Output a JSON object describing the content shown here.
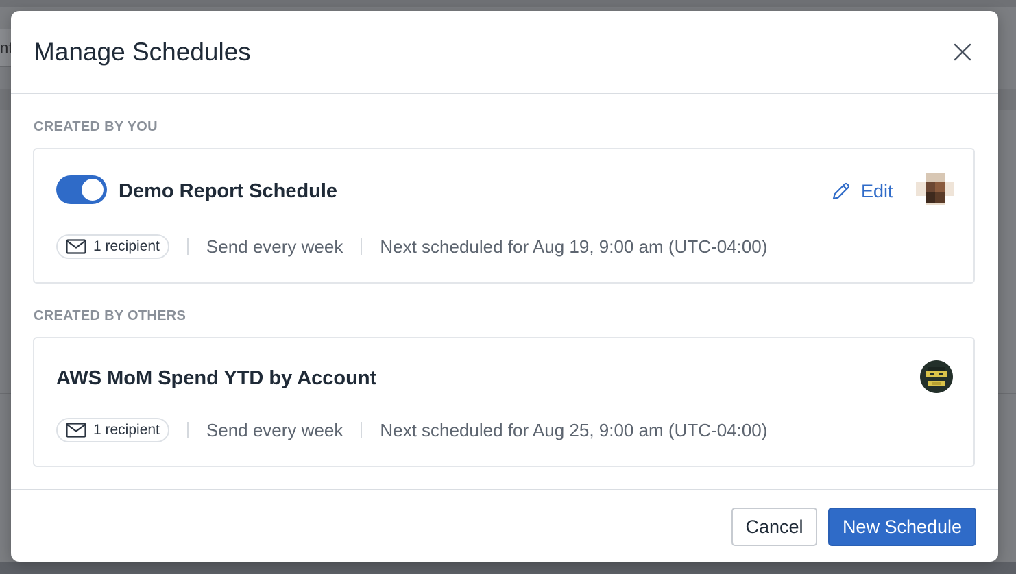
{
  "background": {
    "partial_field_text": "nt"
  },
  "modal": {
    "title": "Manage Schedules",
    "close_icon": "close-icon"
  },
  "sections": [
    {
      "label": "CREATED BY YOU",
      "schedule": {
        "enabled": true,
        "title": "Demo Report Schedule",
        "edit_label": "Edit",
        "recipients": "1 recipient",
        "frequency": "Send every week",
        "next_run": "Next scheduled for Aug 19, 9:00 am (UTC-04:00)"
      }
    },
    {
      "label": "CREATED BY OTHERS",
      "schedule": {
        "title": "AWS MoM Spend YTD by Account",
        "recipients": "1 recipient",
        "frequency": "Send every week",
        "next_run": "Next scheduled for Aug 25, 9:00 am (UTC-04:00)"
      }
    }
  ],
  "footer": {
    "cancel_label": "Cancel",
    "new_label": "New Schedule"
  },
  "colors": {
    "accent": "#2f6bc8",
    "title_text": "#1f2a37",
    "muted_text": "#5d6570",
    "section_label": "#8a9099"
  }
}
